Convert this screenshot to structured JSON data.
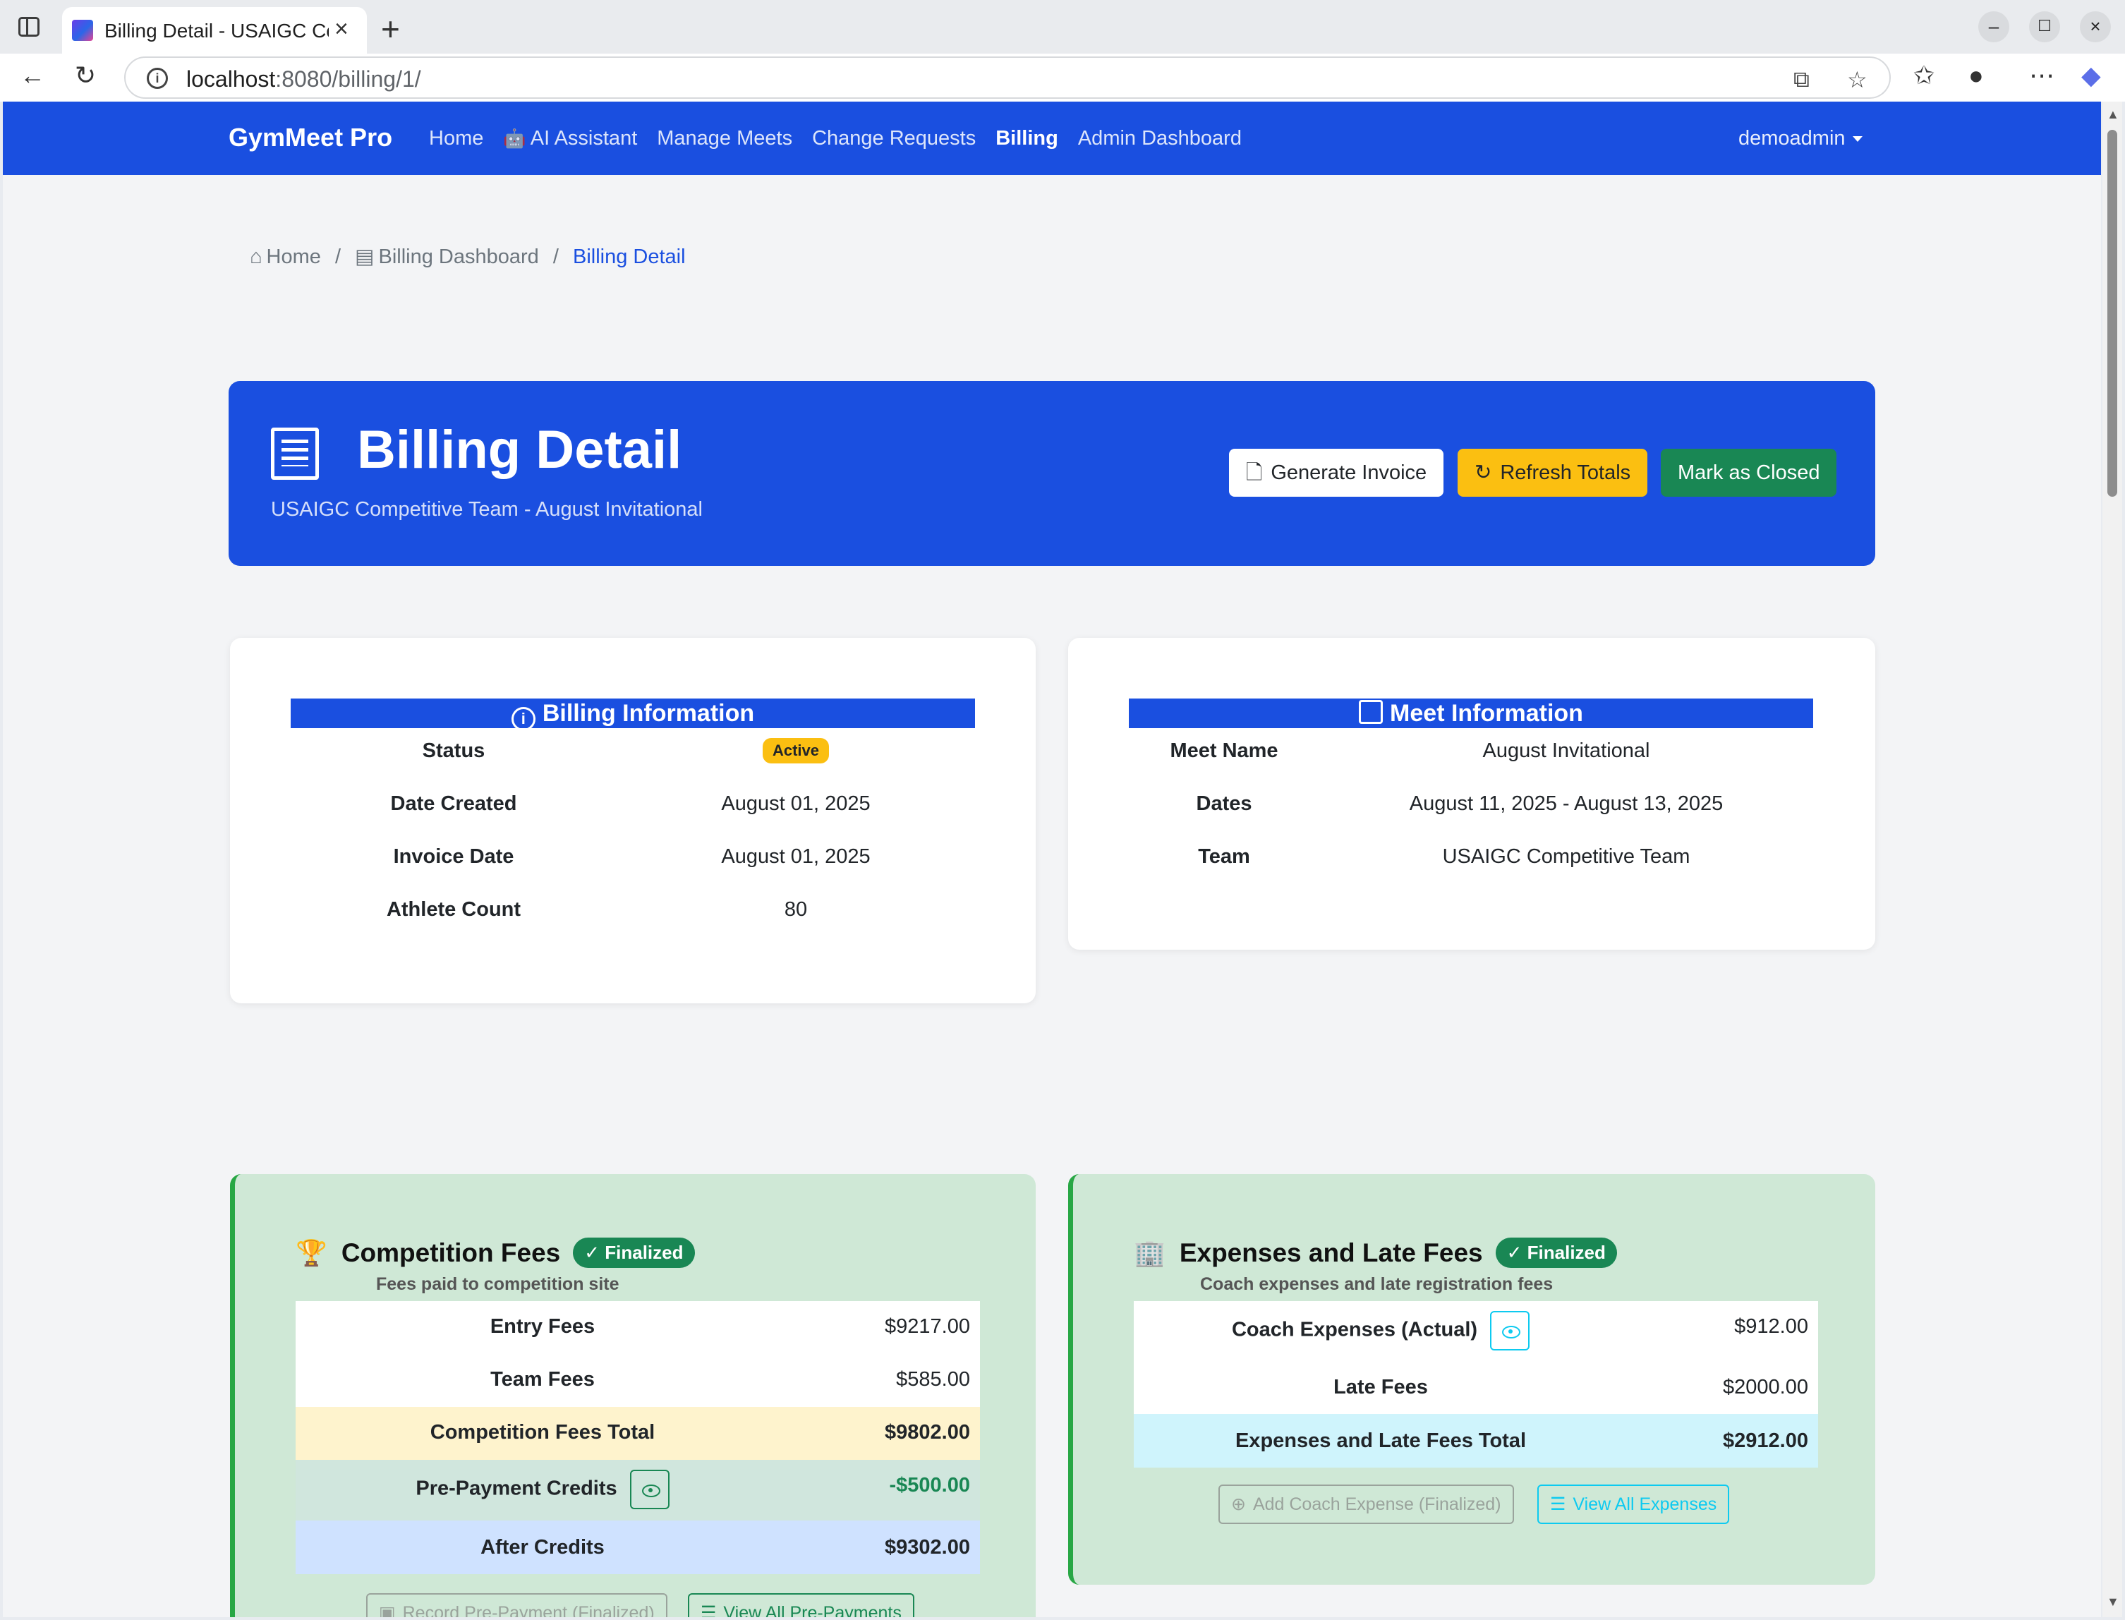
{
  "browser": {
    "tab_title": "Billing Detail - USAIGC Cor",
    "url_host": "localhost",
    "url_path": ":8080/billing/1/"
  },
  "nav": {
    "brand": "GymMeet Pro",
    "links": [
      "Home",
      "AI Assistant",
      "Manage Meets",
      "Change Requests",
      "Billing",
      "Admin Dashboard"
    ],
    "active": "Billing",
    "user": "demoadmin"
  },
  "breadcrumb": {
    "home": "Home",
    "dashboard": "Billing Dashboard",
    "current": "Billing Detail"
  },
  "header": {
    "title": "Billing Detail",
    "subtitle": "USAIGC Competitive Team - August Invitational",
    "btn_generate": "Generate Invoice",
    "btn_refresh": "Refresh Totals",
    "btn_close": "Mark as Closed"
  },
  "billing_info": {
    "heading": "Billing Information",
    "rows": [
      {
        "label": "Status",
        "value": "Active"
      },
      {
        "label": "Date Created",
        "value": "August 01, 2025"
      },
      {
        "label": "Invoice Date",
        "value": "August 01, 2025"
      },
      {
        "label": "Athlete Count",
        "value": "80"
      }
    ]
  },
  "meet_info": {
    "heading": "Meet Information",
    "rows": [
      {
        "label": "Meet Name",
        "value": "August Invitational"
      },
      {
        "label": "Dates",
        "value": "August 11, 2025 - August 13, 2025"
      },
      {
        "label": "Team",
        "value": "USAIGC Competitive Team"
      }
    ]
  },
  "competition_fees": {
    "title": "Competition Fees",
    "badge": "Finalized",
    "subtitle": "Fees paid to competition site",
    "rows": [
      {
        "label": "Entry Fees",
        "value": "$9217.00"
      },
      {
        "label": "Team Fees",
        "value": "$585.00"
      },
      {
        "label": "Competition Fees Total",
        "value": "$9802.00"
      },
      {
        "label": "Pre-Payment Credits",
        "value": "-$500.00"
      },
      {
        "label": "After Credits",
        "value": "$9302.00"
      }
    ],
    "btn_record": "Record Pre-Payment (Finalized)",
    "btn_view": "View All Pre-Payments"
  },
  "expenses": {
    "title": "Expenses and Late Fees",
    "badge": "Finalized",
    "subtitle": "Coach expenses and late registration fees",
    "rows": [
      {
        "label": "Coach Expenses (Actual)",
        "value": "$912.00"
      },
      {
        "label": "Late Fees",
        "value": "$2000.00"
      },
      {
        "label": "Expenses and Late Fees Total",
        "value": "$2912.00"
      }
    ],
    "btn_add": "Add Coach Expense (Finalized)",
    "btn_view": "View All Expenses"
  },
  "colors": {
    "primary": "#1a4fe0",
    "warning": "#fbbf11",
    "success": "#198754",
    "card_green": "#cfe8d6"
  }
}
